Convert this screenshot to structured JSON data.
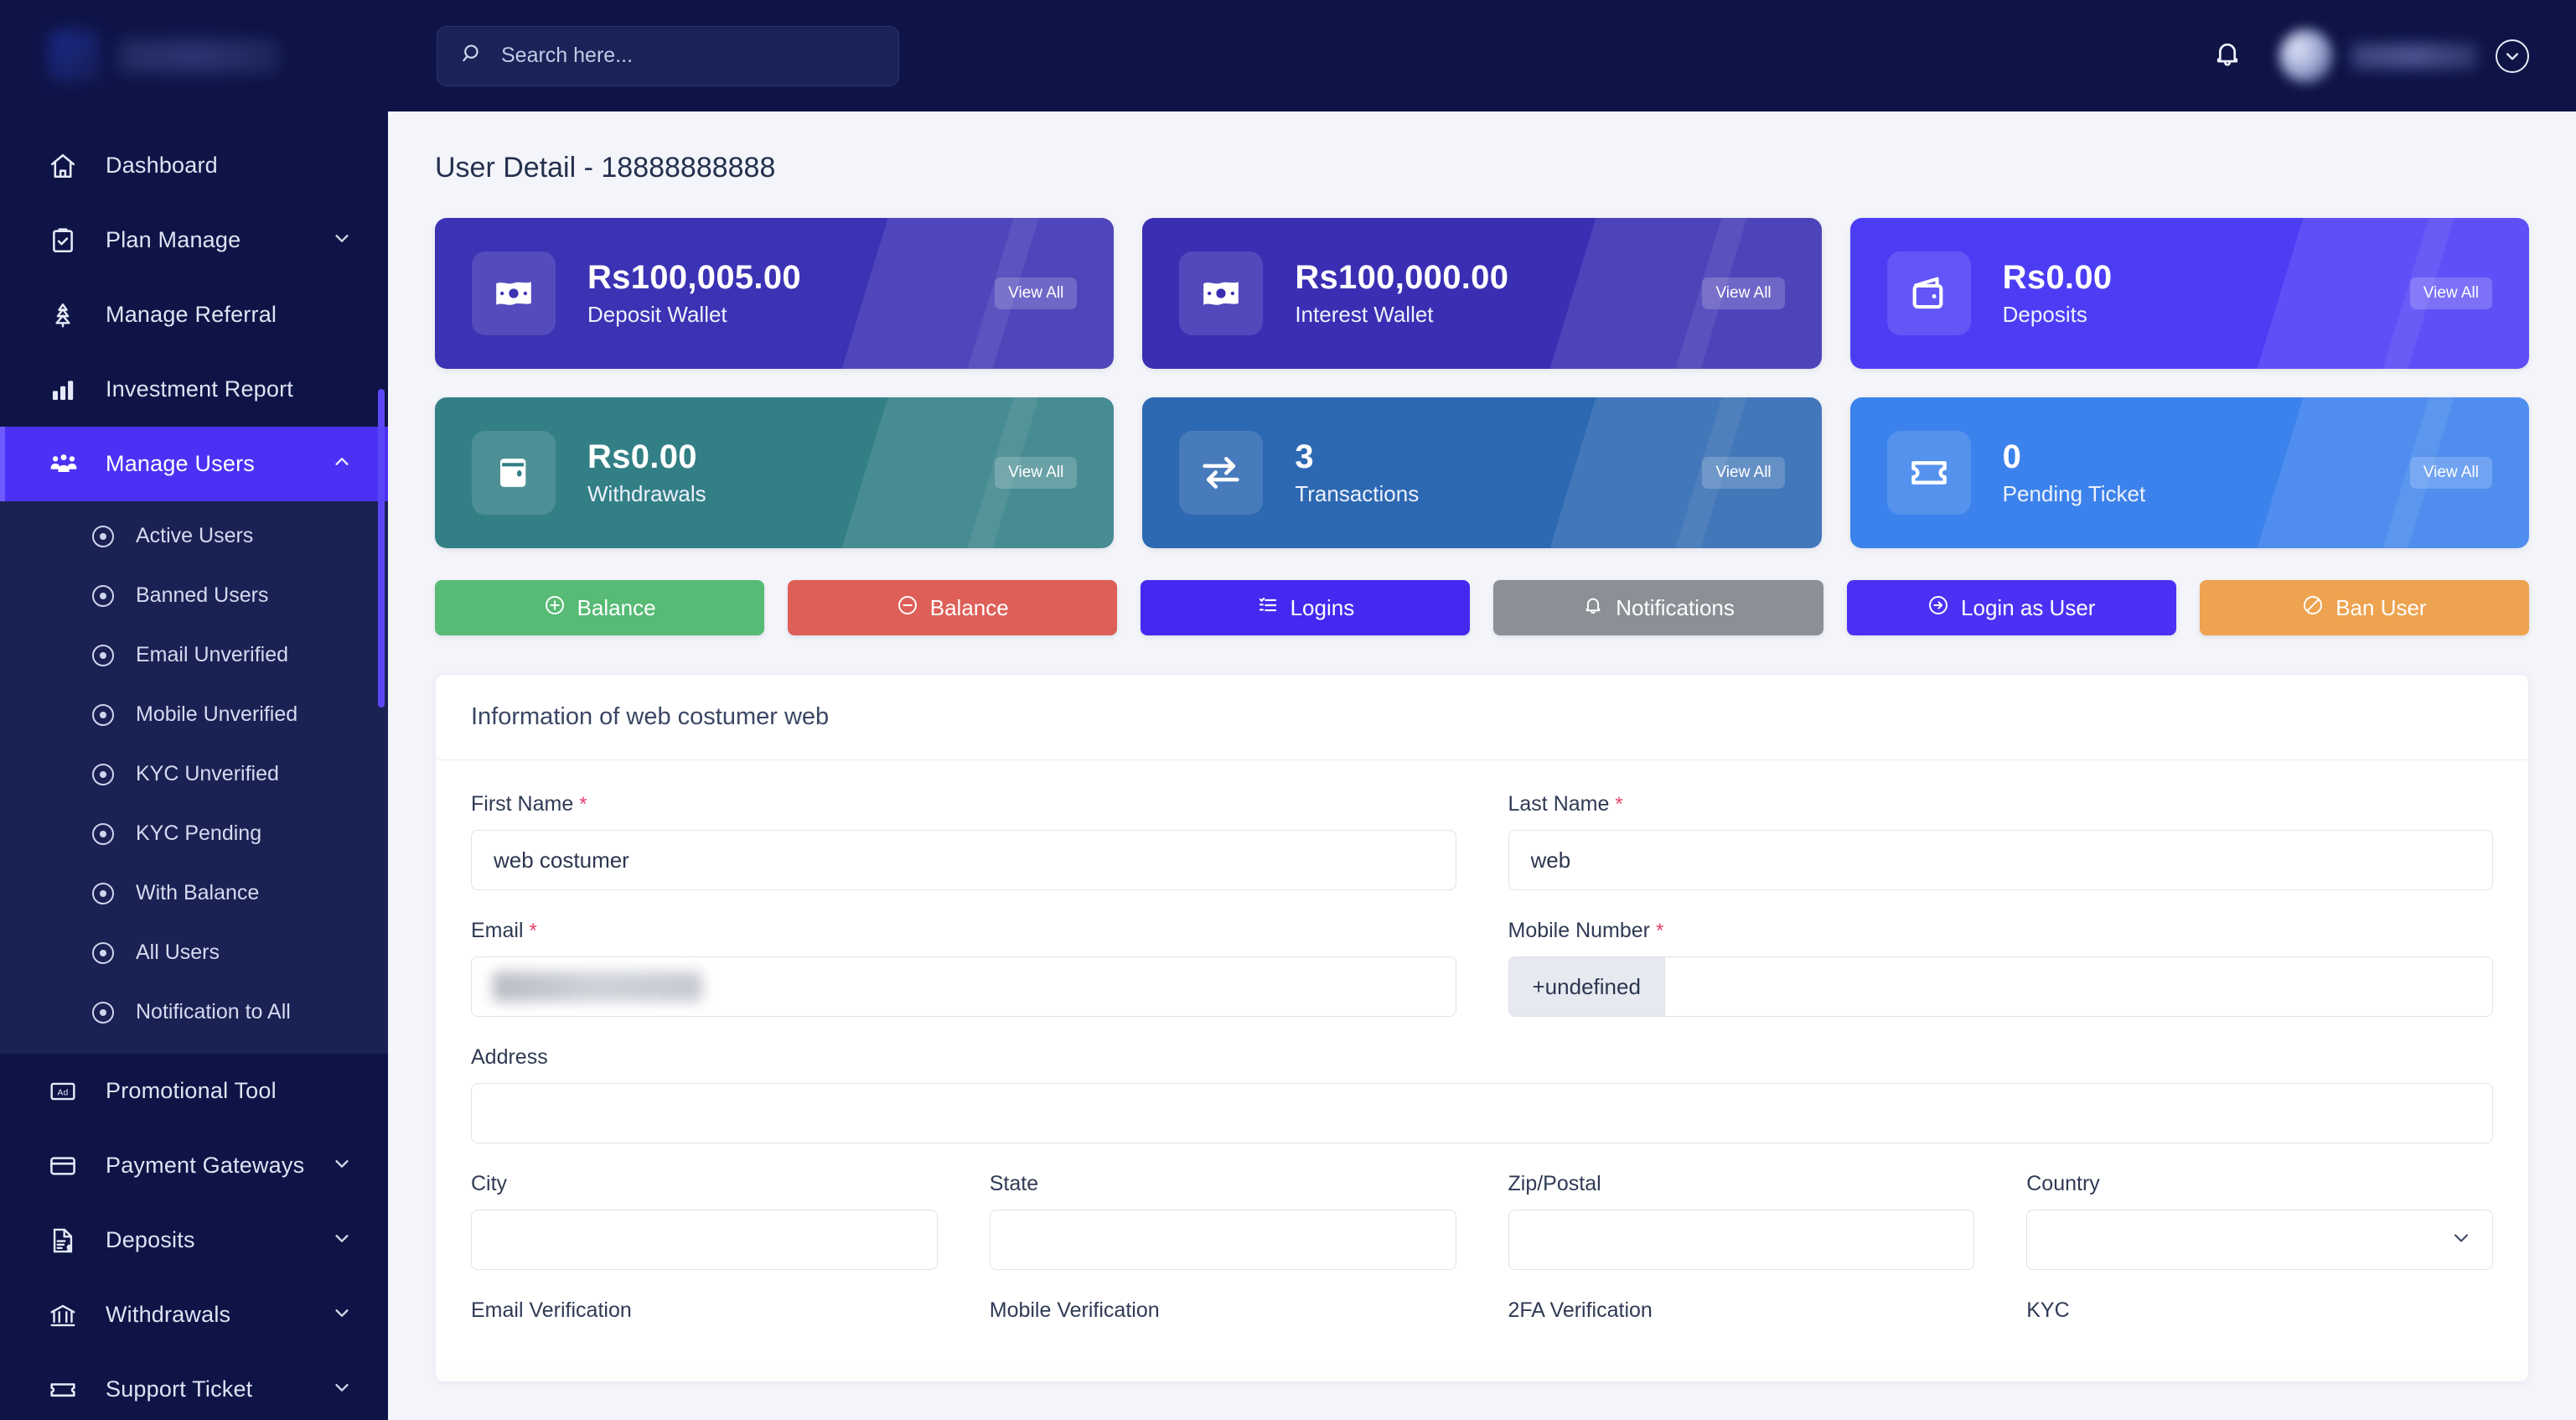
{
  "brand": {
    "logo_alt": "brand-logo"
  },
  "sidebar": {
    "items": [
      {
        "label": "Dashboard",
        "icon": "home-icon",
        "expandable": false
      },
      {
        "label": "Plan Manage",
        "icon": "clipboard-check-icon",
        "expandable": true
      },
      {
        "label": "Manage Referral",
        "icon": "referral-tree-icon",
        "expandable": false
      },
      {
        "label": "Investment Report",
        "icon": "bar-chart-icon",
        "expandable": false
      },
      {
        "label": "Manage Users",
        "icon": "users-group-icon",
        "expandable": true,
        "active": true
      }
    ],
    "submenu": [
      {
        "label": "Active Users"
      },
      {
        "label": "Banned Users"
      },
      {
        "label": "Email Unverified"
      },
      {
        "label": "Mobile Unverified"
      },
      {
        "label": "KYC Unverified"
      },
      {
        "label": "KYC Pending"
      },
      {
        "label": "With Balance"
      },
      {
        "label": "All Users"
      },
      {
        "label": "Notification to All"
      }
    ],
    "items_bottom": [
      {
        "label": "Promotional Tool",
        "icon": "ad-icon",
        "expandable": false
      },
      {
        "label": "Payment Gateways",
        "icon": "credit-card-icon",
        "expandable": true
      },
      {
        "label": "Deposits",
        "icon": "invoice-dollar-icon",
        "expandable": true
      },
      {
        "label": "Withdrawals",
        "icon": "bank-icon",
        "expandable": true
      },
      {
        "label": "Support Ticket",
        "icon": "ticket-icon",
        "expandable": true
      }
    ]
  },
  "topbar": {
    "search_placeholder": "Search here...",
    "search_value": "",
    "notification_icon": "bell-icon",
    "profile_caret_icon": "chevron-down-circle-icon"
  },
  "page": {
    "title": "User Detail - 18888888888"
  },
  "stat_cards": [
    {
      "value": "Rs100,005.00",
      "label": "Deposit Wallet",
      "action": "View All",
      "icon": "money-bill-icon",
      "color": "#3b32b4"
    },
    {
      "value": "Rs100,000.00",
      "label": "Interest Wallet",
      "action": "View All",
      "icon": "money-bill-icon",
      "color": "#3a2fb3"
    },
    {
      "value": "Rs0.00",
      "label": "Deposits",
      "action": "View All",
      "icon": "wallet-icon",
      "color": "#4c3df5"
    },
    {
      "value": "Rs0.00",
      "label": "Withdrawals",
      "action": "View All",
      "icon": "wallet-closed-icon",
      "color": "#337f86"
    },
    {
      "value": "3",
      "label": "Transactions",
      "action": "View All",
      "icon": "exchange-arrows-icon",
      "color": "#2d68b2"
    },
    {
      "value": "0",
      "label": "Pending Ticket",
      "action": "View All",
      "icon": "ticket-icon",
      "color": "#3b82ec"
    }
  ],
  "action_buttons": [
    {
      "label": "Balance",
      "icon": "plus-circle-icon",
      "color": "#57bb76"
    },
    {
      "label": "Balance",
      "icon": "minus-circle-icon",
      "color": "#dd5f58"
    },
    {
      "label": "Logins",
      "icon": "list-icon",
      "color": "#4429f0"
    },
    {
      "label": "Notifications",
      "icon": "bell-icon",
      "color": "#8b8f96"
    },
    {
      "label": "Login as User",
      "icon": "sign-in-icon",
      "color": "#4c31f5"
    },
    {
      "label": "Ban User",
      "icon": "ban-icon",
      "color": "#eda martyr"
    }
  ],
  "form": {
    "heading": "Information of web costumer web",
    "first_name": {
      "label": "First Name",
      "required": true,
      "value": "web costumer"
    },
    "last_name": {
      "label": "Last Name",
      "required": true,
      "value": "web"
    },
    "email": {
      "label": "Email",
      "required": true,
      "value": "",
      "redacted": true
    },
    "mobile": {
      "label": "Mobile Number",
      "required": true,
      "prefix": "+undefined",
      "value": ""
    },
    "address": {
      "label": "Address",
      "required": false,
      "value": ""
    },
    "city": {
      "label": "City",
      "required": false,
      "value": ""
    },
    "state": {
      "label": "State",
      "required": false,
      "value": ""
    },
    "zip": {
      "label": "Zip/Postal",
      "required": false,
      "value": ""
    },
    "country": {
      "label": "Country",
      "required": false,
      "value": ""
    },
    "verification_labels": {
      "email": "Email Verification",
      "mobile": "Mobile Verification",
      "twofa": "2FA Verification",
      "kyc": "KYC"
    }
  },
  "colors": {
    "sidebar_bg": "#0e1446",
    "sidebar_submenu_bg": "#1a2254",
    "accent": "#4c31f5",
    "page_bg": "#f4f5fa",
    "required_star": "#e8436b"
  }
}
